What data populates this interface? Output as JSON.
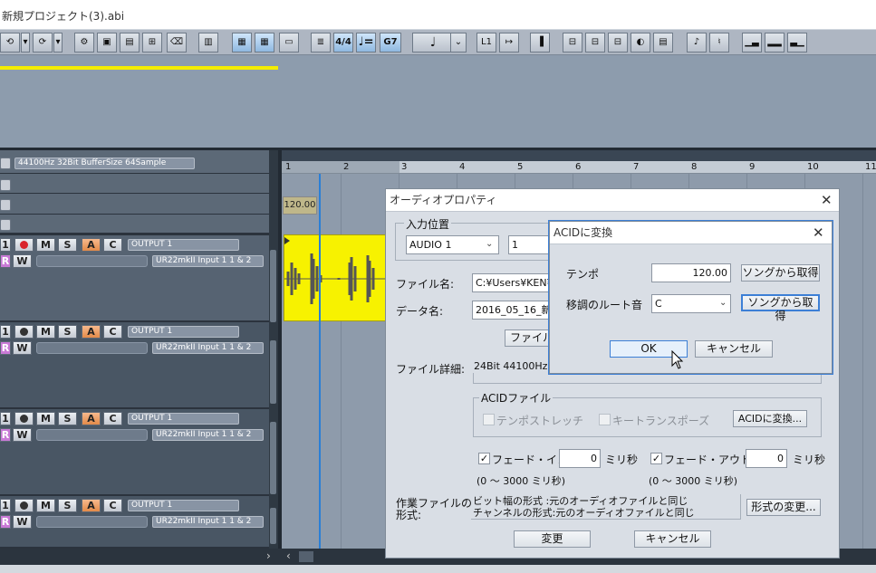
{
  "app": {
    "title": "新規プロジェクト(3).abi"
  },
  "toolbar": {
    "undo": "⟲",
    "redo": "⟳",
    "time_sig": "4/4",
    "chord": "G7",
    "note": "♩",
    "ruler": "L1",
    "icons": [
      "mixer",
      "record",
      "edit",
      "insert",
      "eraser",
      "punch",
      "view-a",
      "view-b",
      "video",
      "score",
      "meter",
      "tempo",
      "chord",
      "note",
      "duration",
      "l1",
      "locate",
      "panel",
      "s1",
      "s2",
      "s3",
      "s4",
      "s5",
      "s6",
      "s7",
      "s8",
      "s9",
      "s10"
    ]
  },
  "project_info": "44100Hz 32Bit BufferSize 64Sample",
  "tracks": [
    {
      "num": "1",
      "m": "M",
      "s": "S",
      "a": "A",
      "c": "C",
      "r": "R",
      "w": "W",
      "output": "OUTPUT 1",
      "input": "UR22mkII Input 1 1 & 2",
      "recording": true
    },
    {
      "num": "1",
      "m": "M",
      "s": "S",
      "a": "A",
      "c": "C",
      "r": "R",
      "w": "W",
      "output": "OUTPUT 1",
      "input": "UR22mkII Input 1 1 & 2",
      "recording": false
    },
    {
      "num": "1",
      "m": "M",
      "s": "S",
      "a": "A",
      "c": "C",
      "r": "R",
      "w": "W",
      "output": "OUTPUT 1",
      "input": "UR22mkII Input 1 1 & 2",
      "recording": false
    },
    {
      "num": "1",
      "m": "M",
      "s": "S",
      "a": "A",
      "c": "C",
      "r": "R",
      "w": "W",
      "output": "OUTPUT 1",
      "input": "UR22mkII Input 1 1 & 2",
      "recording": false
    }
  ],
  "timeline": {
    "bars": [
      "1",
      "2",
      "3",
      "4",
      "5",
      "6",
      "7",
      "8",
      "9",
      "10",
      "11"
    ],
    "tempo": "120.00"
  },
  "audio_props": {
    "title": "オーディオプロパティ",
    "input_position_label": "入力位置",
    "input_track": "AUDIO 1",
    "input_num": "1",
    "file_name_label": "ファイル名:",
    "file_name": "C:¥Users¥KEN¥D",
    "data_name_label": "データ名:",
    "data_name": "2016_05_16_新規",
    "file_button": "ファイル",
    "file_detail_label": "ファイル詳細:",
    "file_detail": "24Bit 44100Hz M",
    "acid_group": "ACIDファイル",
    "tempo_stretch": "テンポストレッチ",
    "key_transpose": "キートランスポーズ",
    "acid_convert_button": "ACIDに変換...",
    "fade_in_label": "フェード・イン",
    "fade_in_value": "0",
    "fade_out_label": "フェード・アウト",
    "fade_out_value": "0",
    "ms": "ミリ秒",
    "range": "(0 〜 3000 ミリ秒)",
    "work_file_label_1": "作業ファイルの",
    "work_file_label_2": "形式:",
    "work_line1": "ビット幅の形式 :元のオーディオファイルと同じ",
    "work_line2": "チャンネルの形式:元のオーディオファイルと同じ",
    "format_change_button": "形式の変更...",
    "change_button": "変更",
    "cancel_button": "キャンセル"
  },
  "acid_dialog": {
    "title": "ACIDに変換",
    "tempo_label": "テンポ",
    "tempo_value": "120.00",
    "get_from_song_1": "ソングから取得",
    "root_label": "移調のルート音",
    "root_value": "C",
    "get_from_song_2": "ソングから取得",
    "ok": "OK",
    "cancel": "キャンセル"
  },
  "colors": {
    "accent": "#3c7fd6",
    "clip": "#f7f200",
    "record": "#d9242c",
    "arm": "#e38a49"
  }
}
